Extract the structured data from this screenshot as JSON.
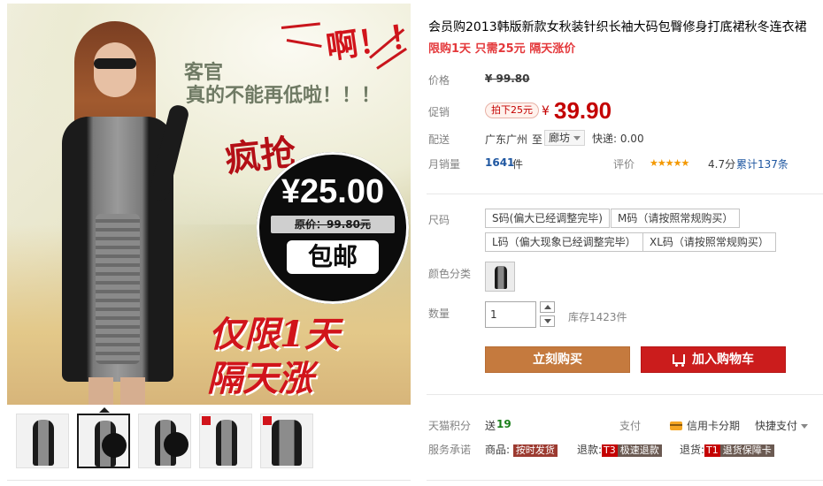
{
  "gallery": {
    "main_image": {
      "text_keguan": "客官",
      "text_dijia": "真的不能再低啦！！！",
      "text_a": "啊！！",
      "text_fengqiang": "疯抢",
      "promo_price": "¥25.00",
      "original_price": "原价：99.80元",
      "free_shipping": "包邮",
      "limit_one_day": "仅限1天",
      "price_up": "隔天涨价！！"
    },
    "thumbnails": [
      {
        "label": "thumbnail-1"
      },
      {
        "label": "thumbnail-2"
      },
      {
        "label": "thumbnail-3"
      },
      {
        "label": "thumbnail-4"
      },
      {
        "label": "thumbnail-5"
      }
    ]
  },
  "product": {
    "title": "会员购2013韩版新款女秋装针织长袖大码包臀修身打底裙秋冬连衣裙",
    "subtitle": "限购1天 只需25元 隔天涨价",
    "price": {
      "label": "价格",
      "original": "¥ 99.80"
    },
    "promo": {
      "label": "促销",
      "tag": "拍下25元",
      "currency": "¥",
      "value": "39.90"
    },
    "shipping": {
      "label": "配送",
      "from": "广东广州",
      "to_label": "至",
      "to": "廊坊",
      "express": "快递: 0.00"
    },
    "sales": {
      "label": "月销量",
      "value": "1641",
      "unit": "件"
    },
    "rating": {
      "label": "评价",
      "stars": "★★★★★",
      "score": "4.7分",
      "total": "累计137条"
    },
    "size": {
      "label": "尺码",
      "options": [
        "S码(偏大已经调整完毕)",
        "M码（请按照常规购买）",
        "L码（偏大现象已经调整完毕）",
        "XL码（请按照常规购买）"
      ]
    },
    "color": {
      "label": "颜色分类"
    },
    "quantity": {
      "label": "数量",
      "value": "1",
      "stock": "库存1423件"
    },
    "buttons": {
      "buy_now": "立刻购买",
      "add_cart": "加入购物车"
    },
    "points": {
      "label": "天猫积分",
      "prefix": "送",
      "value": "19"
    },
    "payment": {
      "label": "支付",
      "credit": "信用卡分期",
      "quick": "快捷支付"
    },
    "service": {
      "label": "服务承诺",
      "goods_label": "商品:",
      "goods_badge": "按时发货",
      "refund_label": "退款:",
      "refund_code": "T3",
      "refund_badge": "极速退款",
      "return_label": "退货:",
      "return_code": "T1",
      "return_badge": "退货保障卡"
    }
  }
}
